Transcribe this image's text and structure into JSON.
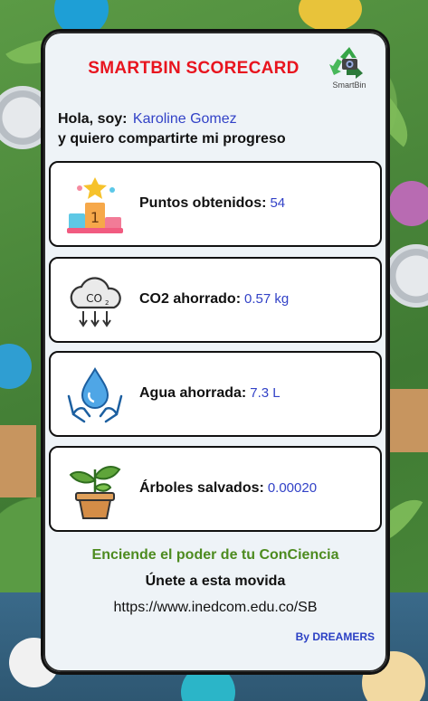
{
  "card": {
    "title": "SMARTBIN SCORECARD",
    "logo_text": "SmartBin",
    "greeting_prefix": "Hola, soy:",
    "user_name": "Karoline Gomez",
    "greeting_suffix": "y quiero compartirte mi progreso"
  },
  "stats": [
    {
      "icon": "podium-icon",
      "label": "Puntos obtenidos:",
      "value": "54"
    },
    {
      "icon": "co2-cloud-icon",
      "label": "CO2 ahorrado:",
      "value": "0.57 kg"
    },
    {
      "icon": "water-hands-icon",
      "label": "Agua ahorrada:",
      "value": "7.3 L"
    },
    {
      "icon": "plant-icon",
      "label": "Árboles salvados:",
      "value": "0.00020"
    }
  ],
  "footer": {
    "slogan": "Enciende el poder de tu ConCiencia",
    "cta": "Únete a esta movida",
    "url": "https://www.inedcom.edu.co/SB",
    "credit": "By DREAMERS"
  },
  "colors": {
    "title": "#e8141e",
    "value": "#3242c7",
    "slogan": "#4d8b1f",
    "credit": "#2a3fc4"
  }
}
